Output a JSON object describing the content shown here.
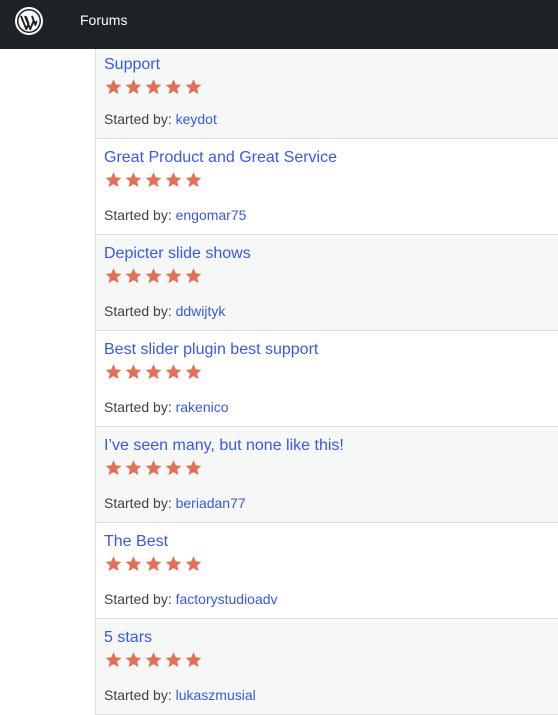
{
  "header": {
    "logo_icon": "wordpress-logo-icon",
    "nav_forums": "Forums"
  },
  "colors": {
    "topbar": "#1d2327",
    "link": "#3858e9",
    "star": "#e26f56"
  },
  "topics": [
    {
      "title": "Support",
      "started_by_label": "Started by:",
      "author": "keydot",
      "rating": 5
    },
    {
      "title": "Great Product and Great Service",
      "started_by_label": "Started by:",
      "author": "engomar75",
      "rating": 5
    },
    {
      "title": "Depicter slide shows",
      "started_by_label": "Started by:",
      "author": "ddwijtyk",
      "rating": 5
    },
    {
      "title": "Best slider plugin best support",
      "started_by_label": "Started by:",
      "author": "rakenico",
      "rating": 5
    },
    {
      "title": "I’ve seen many, but none like this!",
      "started_by_label": "Started by:",
      "author": "beriadan77",
      "rating": 5
    },
    {
      "title": "The Best",
      "started_by_label": "Started by:",
      "author": "factorystudioadv",
      "rating": 5
    },
    {
      "title": "5 stars",
      "started_by_label": "Started by:",
      "author": "lukaszmusial",
      "rating": 5
    }
  ]
}
